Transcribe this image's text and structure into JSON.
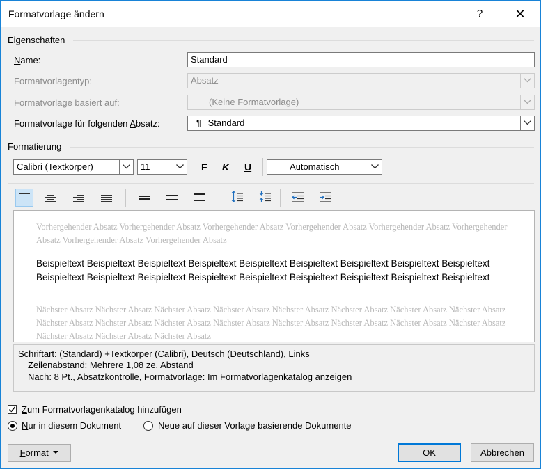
{
  "window": {
    "title": "Formatvorlage ändern",
    "help": "?",
    "close": "✕"
  },
  "properties": {
    "section": "Eigenschaften",
    "name_label": "Name:",
    "name_value": "Standard",
    "type_label": "Formatvorlagentyp:",
    "type_value": "Absatz",
    "based_label": "Formatvorlage basiert auf:",
    "based_value": "(Keine Formatvorlage)",
    "next_label": "Formatvorlage für folgenden Absatz:",
    "next_value": "Standard",
    "next_icon": "¶"
  },
  "formatting": {
    "section": "Formatierung",
    "font": "Calibri (Textkörper)",
    "size": "11",
    "bold": "F",
    "italic": "K",
    "underline": "U",
    "color": "Automatisch",
    "tools": [
      "align-left-icon",
      "align-center-icon",
      "align-right-icon",
      "align-justify-icon",
      "single-spacing-icon",
      "one-half-spacing-icon",
      "double-spacing-icon",
      "increase-paragraph-spacing-icon",
      "decrease-paragraph-spacing-icon",
      "decrease-indent-icon",
      "increase-indent-icon"
    ]
  },
  "preview": {
    "previous": "Vorhergehender Absatz Vorhergehender Absatz Vorhergehender Absatz Vorhergehender Absatz Vorhergehender Absatz Vorhergehender Absatz Vorhergehender Absatz Vorhergehender Absatz",
    "sample": "Beispieltext Beispieltext Beispieltext Beispieltext Beispieltext Beispieltext Beispieltext Beispieltext Beispieltext Beispieltext Beispieltext Beispieltext Beispieltext Beispieltext Beispieltext Beispieltext Beispieltext Beispieltext",
    "next": "Nächster Absatz Nächster Absatz Nächster Absatz Nächster Absatz Nächster Absatz Nächster Absatz Nächster Absatz Nächster Absatz Nächster Absatz Nächster Absatz Nächster Absatz Nächster Absatz Nächster Absatz Nächster Absatz Nächster Absatz Nächster Absatz Nächster Absatz Nächster Absatz Nächster Absatz"
  },
  "description": {
    "line1": "Schriftart: (Standard) +Textkörper (Calibri), Deutsch (Deutschland), Links",
    "line2": "Zeilenabstand:  Mehrere 1,08 ze, Abstand",
    "line3": "Nach:  8 Pt., Absatzkontrolle, Formatvorlage: Im Formatvorlagenkatalog anzeigen"
  },
  "options": {
    "add_to_gallery": "Zum Formatvorlagenkatalog hinzufügen",
    "add_checked": true,
    "only_doc": "Nur in diesem Dokument",
    "new_docs": "Neue auf dieser Vorlage basierende Dokumente",
    "selected": "only_doc"
  },
  "buttons": {
    "format": "Format",
    "ok": "OK",
    "cancel": "Abbrechen"
  },
  "colors": {
    "accent": "#0078d7",
    "active_tool": "#cce4f7"
  }
}
